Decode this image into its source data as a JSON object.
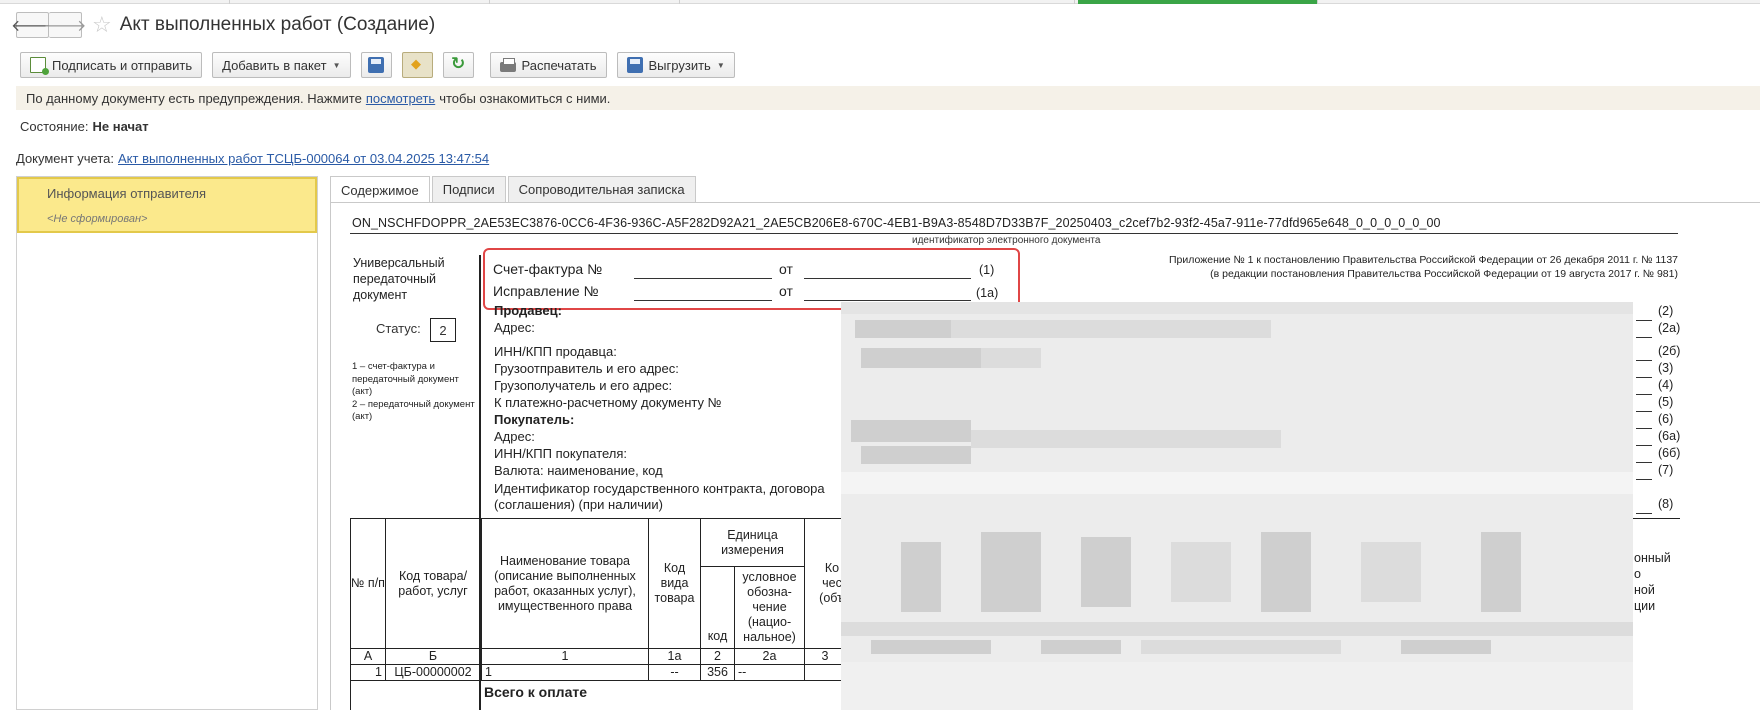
{
  "window": {
    "title": "Акт выполненных работ (Создание)"
  },
  "toolbar": {
    "sign_send": "Подписать и отправить",
    "add_package": "Добавить в пакет",
    "print": "Распечатать",
    "export": "Выгрузить"
  },
  "warning": {
    "text_before": "По данному документу есть предупреждения. Нажмите",
    "link": "посмотреть",
    "text_after": "чтобы ознакомиться с ними."
  },
  "state": {
    "label": "Состояние:",
    "value": "Не начат"
  },
  "docref": {
    "label": "Документ учета:",
    "link": "Акт выполненных работ ТСЦБ-000064 от 03.04.2025 13:47:54"
  },
  "left_panel": {
    "item_title": "Информация отправителя",
    "item_status": "<Не сформирован>"
  },
  "tabs": [
    "Содержимое",
    "Подписи",
    "Сопроводительная записка"
  ],
  "document": {
    "file_id": "ON_NSCHFDOPPR_2AE53EC3876-0CC6-4F36-936C-A5F282D92A21_2AE5CB206E8-670C-4EB1-B9A3-8548D7D33B7F_20250403_c2cef7b2-93f2-45a7-911e-77dfd965e648_0_0_0_0_0_00",
    "file_id_caption": "идентификатор электронного документа",
    "upd_title": "Универсальный передаточный документ",
    "status_label": "Статус:",
    "status_value": "2",
    "status_note_1": "1 – счет-фактура и передаточный документ (акт)",
    "status_note_2": "2 – передаточный документ (акт)",
    "invoice_label": "Счет-фактура №",
    "correction_label": "Исправление №",
    "from_label": "от",
    "num_1": "(1)",
    "num_1a": "(1а)",
    "annex_1": "Приложение № 1 к постановлению Правительства Российской Федерации от 26 декабря 2011 г. № 1137",
    "annex_2": "(в редакции постановления Правительства Российской Федерации от 19 августа 2017 г. № 981)",
    "fields": {
      "seller": "Продавец:",
      "address1": "Адрес:",
      "seller_inn": "ИНН/КПП продавца:",
      "shipper": "Грузоотправитель и его адрес:",
      "consignee": "Грузополучатель и его адрес:",
      "payment_doc": "К платежно-расчетному документу №",
      "buyer": "Покупатель:",
      "address2": "Адрес:",
      "buyer_inn": "ИНН/КПП покупателя:",
      "currency": "Валюта: наименование, код",
      "contract_1": "Идентификатор государственного контракта, договора",
      "contract_2": "(соглашения) (при наличии)"
    },
    "row_nums": [
      "(2)",
      "(2а)",
      "(2б)",
      "(3)",
      "(4)",
      "(5)",
      "(6)",
      "(6а)",
      "(6б)",
      "(7)",
      "(8)"
    ]
  },
  "table": {
    "headers": {
      "num": "№ п/п",
      "code": "Код товара/ работ, услуг",
      "name": "Наименование товара (описание выполненных работ, оказанных услуг), имущественного права",
      "kind": "Код вида товара",
      "unit": "Единица измерения",
      "unit_code": "код",
      "unit_sym": "условное обозна-чение (нацио-нальное)",
      "qty_cut": "Ко чес (объ",
      "right_cut": "онный о ной ции"
    },
    "colnums": [
      "А",
      "Б",
      "1",
      "1а",
      "2",
      "2а",
      "3"
    ],
    "row": {
      "num": "1",
      "code": "ЦБ-00000002",
      "name": "1",
      "kind": "--",
      "unit_code": "356",
      "unit_sym": "--"
    },
    "total": "Всего к оплате"
  }
}
